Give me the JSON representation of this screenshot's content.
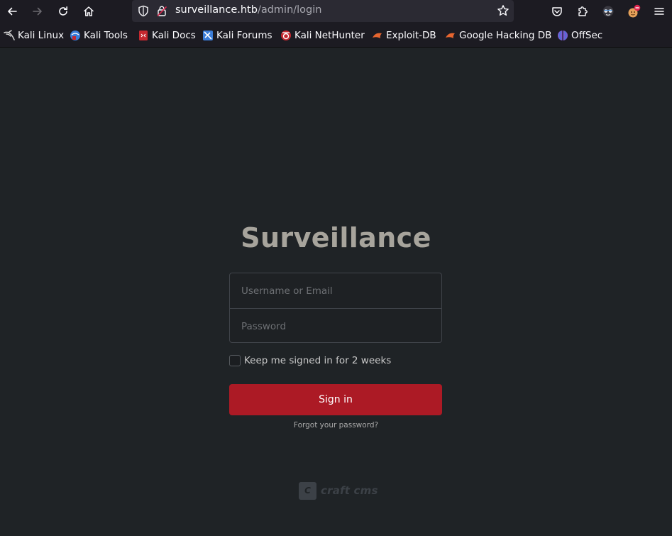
{
  "browser": {
    "url": {
      "host": "surveillance.htb",
      "path": "/admin/login"
    },
    "icons": {
      "back": "arrow-left-icon",
      "forward": "arrow-right-icon",
      "reload": "reload-icon",
      "home": "home-icon",
      "shield": "shield-icon",
      "lock": "lock-icon",
      "star": "star-icon",
      "pocket": "pocket-icon",
      "extensions": "puzzle-icon",
      "account": "account-icon",
      "profile": "profile-icon",
      "menu": "hamburger-menu-icon"
    }
  },
  "bookmarks": [
    {
      "label": "Kali Linux",
      "icon": "kali-dragon-icon",
      "color": "#d8d8d8"
    },
    {
      "label": "Kali Tools",
      "icon": "kali-tools-icon",
      "color": "#3b7dd8"
    },
    {
      "label": "Kali Docs",
      "icon": "kali-docs-icon",
      "color": "#c5282f"
    },
    {
      "label": "Kali Forums",
      "icon": "kali-forums-icon",
      "color": "#3b7dd8"
    },
    {
      "label": "Kali NetHunter",
      "icon": "kali-nethunter-icon",
      "color": "#c5282f"
    },
    {
      "label": "Exploit-DB",
      "icon": "exploit-db-icon",
      "color": "#e6652f"
    },
    {
      "label": "Google Hacking DB",
      "icon": "ghdb-icon",
      "color": "#e6652f"
    },
    {
      "label": "OffSec",
      "icon": "offsec-icon",
      "color": "#7a5bd1"
    }
  ],
  "login": {
    "title": "Surveillance",
    "username_placeholder": "Username or Email",
    "password_placeholder": "Password",
    "remember_label": "Keep me signed in for 2 weeks",
    "signin_label": "Sign in",
    "forgot_label": "Forgot your password?"
  },
  "footer": {
    "brand_mark": "C",
    "brand_text": "craft cms"
  },
  "colors": {
    "page_background": "#1f2326",
    "signin_button": "#ac1a25",
    "title_text": "#a7a49c"
  }
}
